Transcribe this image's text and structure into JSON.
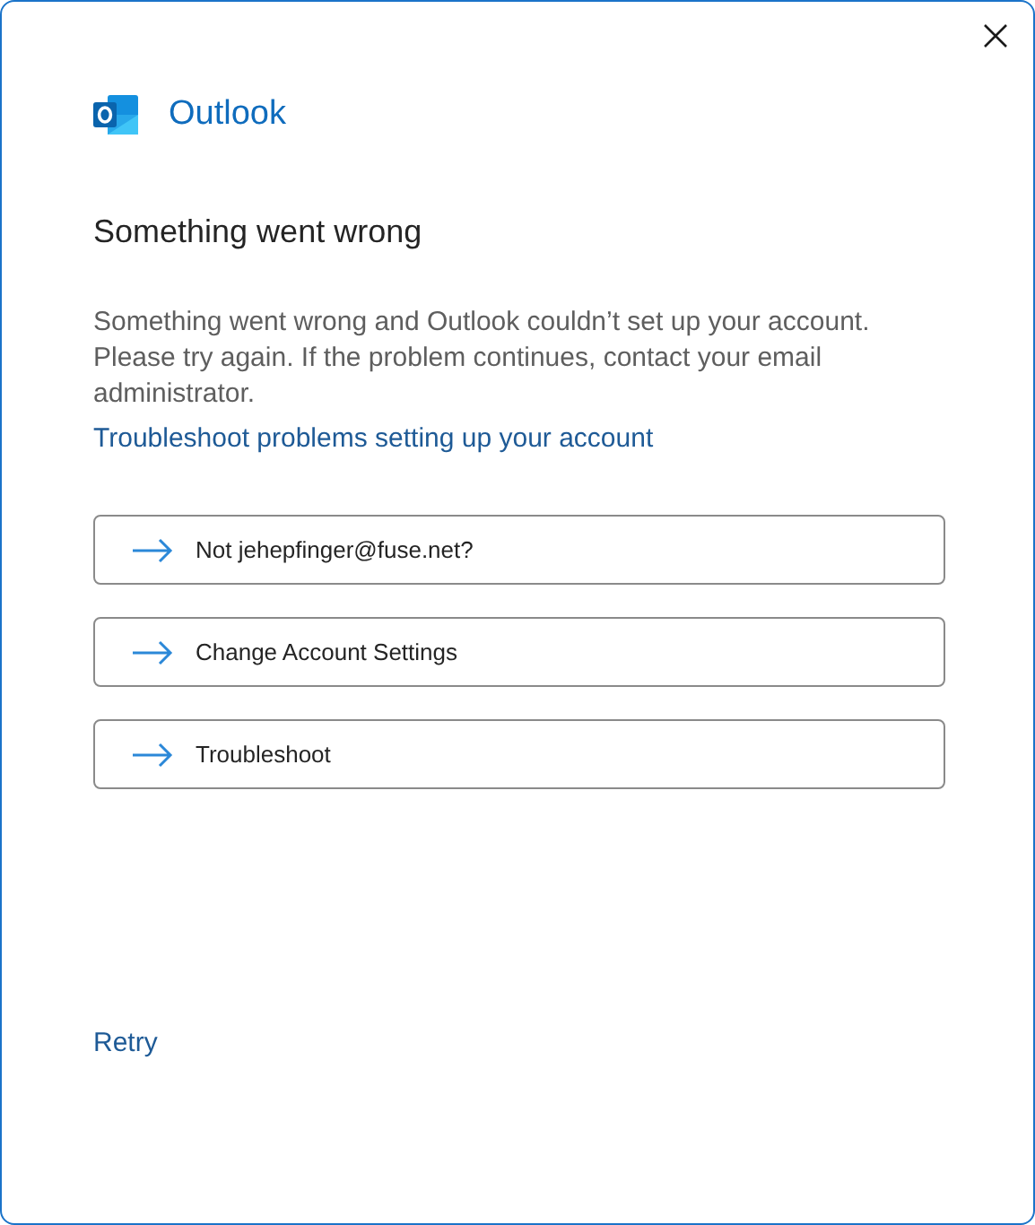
{
  "app": {
    "name": "Outlook"
  },
  "heading": "Something went wrong",
  "message": "Something went wrong and Outlook couldn’t set up your account. Please try again. If the problem continues, contact your email administrator.",
  "help_link": "Troubleshoot problems setting up your account",
  "options": [
    {
      "label": "Not jehepfinger@fuse.net?"
    },
    {
      "label": "Change Account Settings"
    },
    {
      "label": "Troubleshoot"
    }
  ],
  "retry": "Retry"
}
